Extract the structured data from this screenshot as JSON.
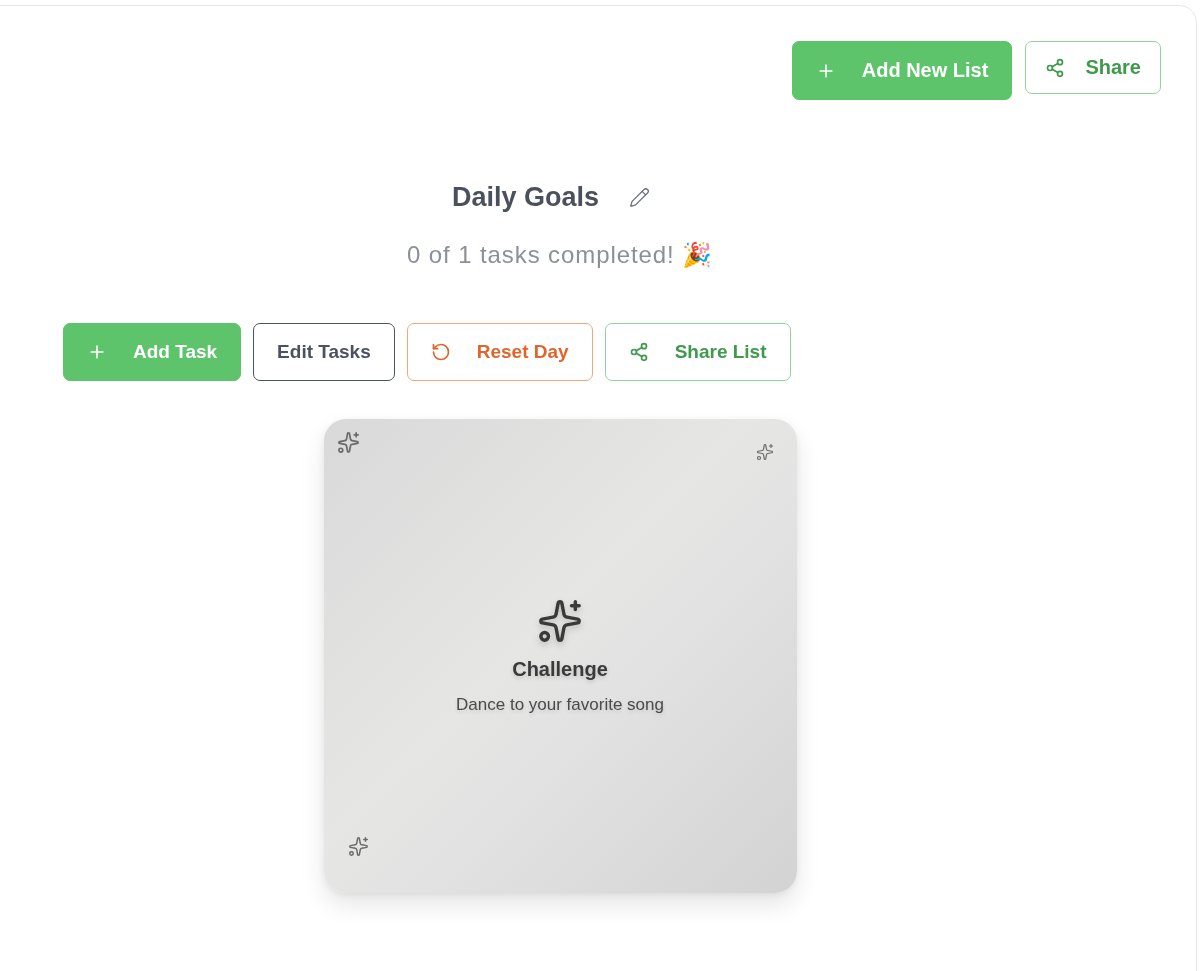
{
  "header": {
    "buttons": [
      {
        "kind": "add",
        "label": "Add New List"
      },
      {
        "kind": "share",
        "label": "Share"
      }
    ]
  },
  "list": {
    "title": "Daily Goals",
    "progress": "0 of 1 tasks completed! 🎉"
  },
  "actions": [
    {
      "kind": "add",
      "label": "Add Task"
    },
    {
      "kind": "edit",
      "label": "Edit Tasks"
    },
    {
      "kind": "reset",
      "label": "Reset Day"
    },
    {
      "kind": "share",
      "label": "Share List"
    }
  ],
  "challenge_card": {
    "heading": "Challenge",
    "text": "Dance to your favorite song"
  }
}
